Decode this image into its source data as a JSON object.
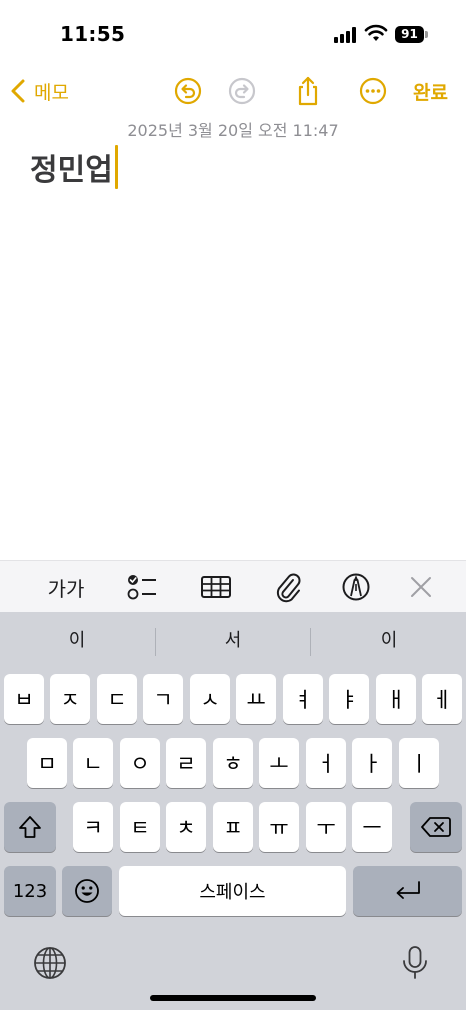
{
  "status": {
    "time": "11:55",
    "battery": "91"
  },
  "nav": {
    "back_label": "메모",
    "done_label": "완료"
  },
  "note": {
    "date": "2025년 3월 20일 오전 11:47",
    "title": "정민업"
  },
  "format_bar": {
    "text_style_label": "가가"
  },
  "keyboard": {
    "predictions": [
      "이",
      "서",
      "이"
    ],
    "row1": [
      "ㅂ",
      "ㅈ",
      "ㄷ",
      "ㄱ",
      "ㅅ",
      "ㅛ",
      "ㅕ",
      "ㅑ",
      "ㅐ",
      "ㅔ"
    ],
    "row2": [
      "ㅁ",
      "ㄴ",
      "ㅇ",
      "ㄹ",
      "ㅎ",
      "ㅗ",
      "ㅓ",
      "ㅏ",
      "ㅣ"
    ],
    "row3": [
      "ㅋ",
      "ㅌ",
      "ㅊ",
      "ㅍ",
      "ㅠ",
      "ㅜ",
      "ㅡ"
    ],
    "numbers_label": "123",
    "space_label": "스페이스"
  },
  "colors": {
    "accent": "#e0a800",
    "keyboard_bg": "#d1d3d9",
    "key_dark": "#aab0bb"
  }
}
